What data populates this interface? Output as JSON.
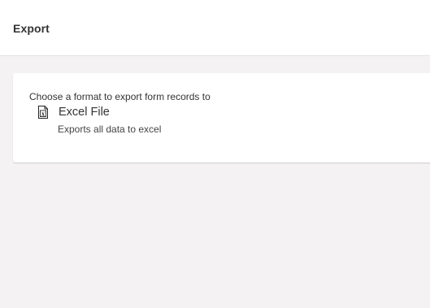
{
  "header": {
    "title": "Export"
  },
  "card": {
    "prompt": "Choose a format to export form records to",
    "options": [
      {
        "icon": "excel-file-icon",
        "icon_glyph": "x",
        "label": "Excel File",
        "description": "Exports all data to excel"
      }
    ]
  },
  "colors": {
    "background": "#f4f2f2",
    "surface": "#ffffff",
    "text": "#333333"
  }
}
